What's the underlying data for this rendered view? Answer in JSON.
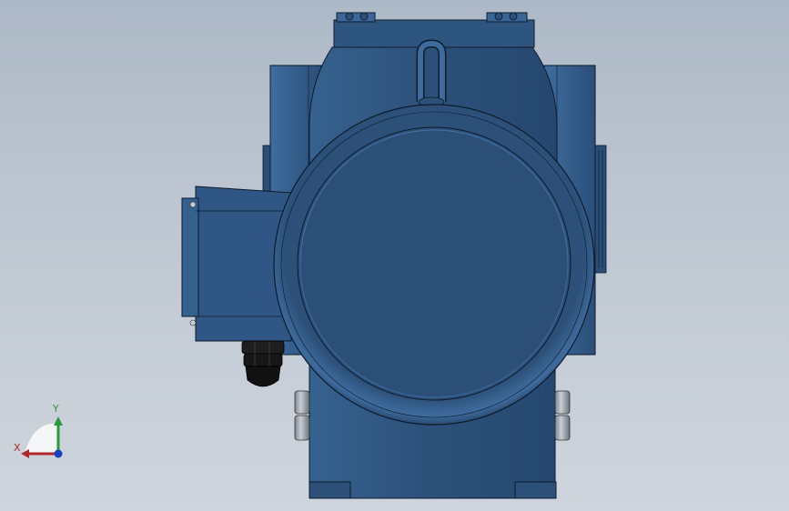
{
  "viewport": {
    "background_top": "#aeb9c7",
    "background_bottom": "#cfd5dc"
  },
  "model": {
    "body_color": "#2c5078",
    "highlight_color": "#3d6a9c",
    "edge_color": "#0d1b2a",
    "gland_color": "#1a1a1a"
  },
  "triad": {
    "x_label": "X",
    "y_label": "Y",
    "x_color": "#b0282c",
    "y_color": "#2a9a3a",
    "z_color": "#1a3fc0"
  }
}
